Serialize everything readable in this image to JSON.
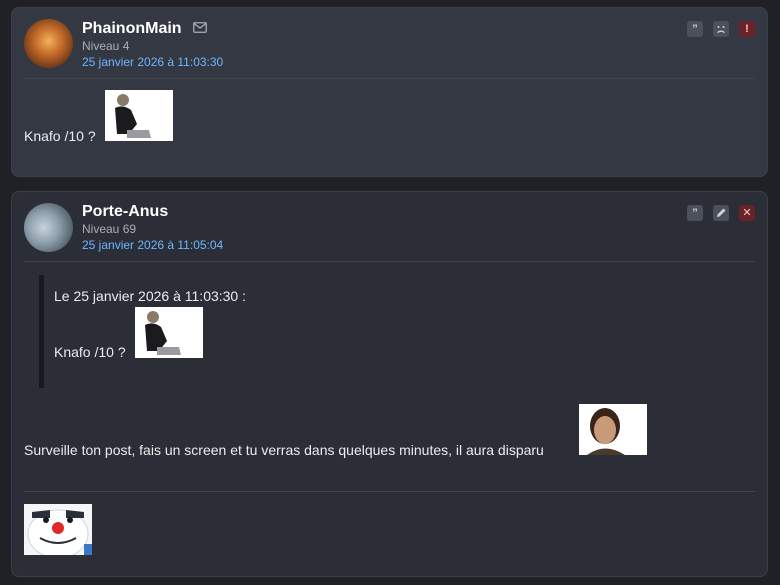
{
  "posts": [
    {
      "username": "PhainonMain",
      "level": "Niveau 4",
      "date": "25 janvier 2026 à 11:03:30",
      "message": "Knafo /10 ?",
      "actions": [
        "quote",
        "sad",
        "report"
      ]
    },
    {
      "username": "Porte-Anus",
      "level": "Niveau 69",
      "date": "25 janvier 2026 à 11:05:04",
      "quote_header": "Le 25 janvier 2026 à 11:03:30 :",
      "quote_text": "Knafo /10 ?",
      "message": "Surveille ton post, fais un screen et tu verras dans quelques minutes, il aura disparu",
      "actions": [
        "quote",
        "edit",
        "delete"
      ]
    }
  ],
  "icons": {
    "quote": "”",
    "sad": "sad-face",
    "report": "!",
    "edit": "pencil",
    "delete": "✕"
  }
}
